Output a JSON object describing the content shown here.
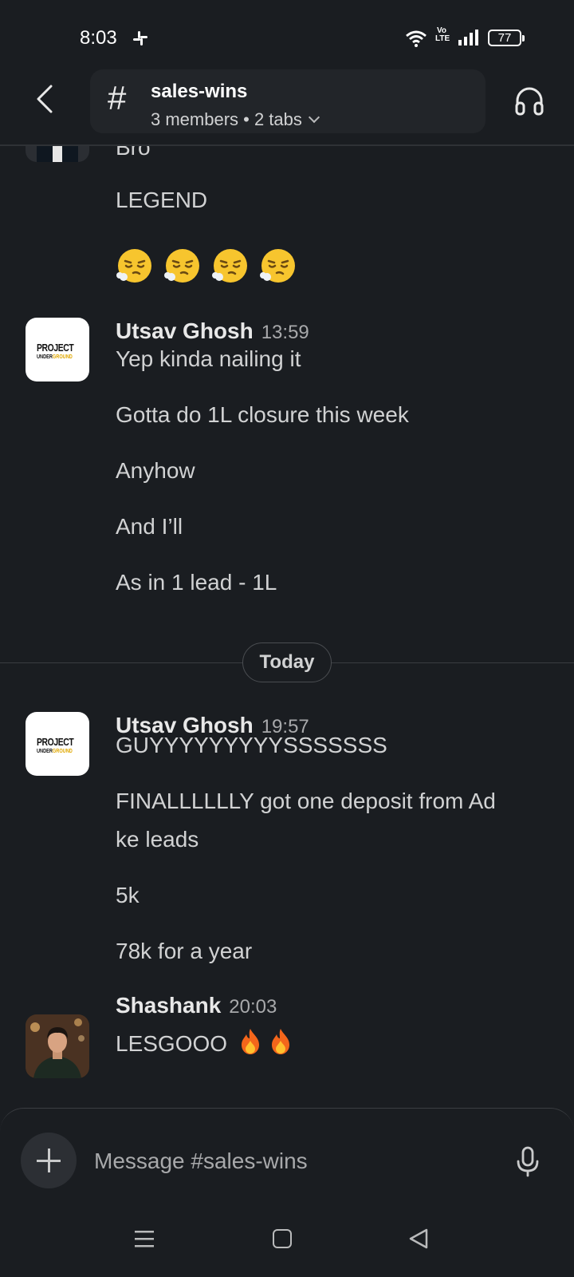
{
  "status_bar": {
    "time": "8:03",
    "network": "Vo\nLTE",
    "battery": "77"
  },
  "header": {
    "channel_hash": "#",
    "channel_name": "sales-wins",
    "channel_meta": "3 members • 2 tabs"
  },
  "messages": {
    "earlier": {
      "lines": [
        "Bro",
        "LEGEND"
      ],
      "emojis": [
        "😮‍💨",
        "😮‍💨",
        "😮‍💨",
        "😮‍💨"
      ]
    },
    "msg1": {
      "sender": "Utsav Ghosh",
      "time": "13:59",
      "lines": [
        "Yep kinda nailing it",
        "Gotta do 1L closure this week",
        "Anyhow",
        "And I’ll",
        "As in 1 lead - 1L"
      ]
    },
    "day_divider": "Today",
    "msg2": {
      "sender": "Utsav Ghosh",
      "time": "19:57",
      "lines": [
        "GUYYYYYYYYYSSSSSSS",
        "FINALLLLLLY got one deposit from Ad",
        "ke leads",
        "5k",
        "78k for a year"
      ]
    },
    "msg3": {
      "sender": "Shashank",
      "time": "20:03",
      "text": "LESGOOO",
      "emojis": [
        "🔥",
        "🔥"
      ]
    }
  },
  "avatar_logo": {
    "top": "PROJECT",
    "bottom_a": "UNDER",
    "bottom_b": "GROUND"
  },
  "composer": {
    "placeholder": "Message #sales-wins"
  },
  "colors": {
    "background": "#1a1d21",
    "text": "#d1d2d3",
    "header_box": "#222529",
    "logo_accent": "#e0a800"
  }
}
